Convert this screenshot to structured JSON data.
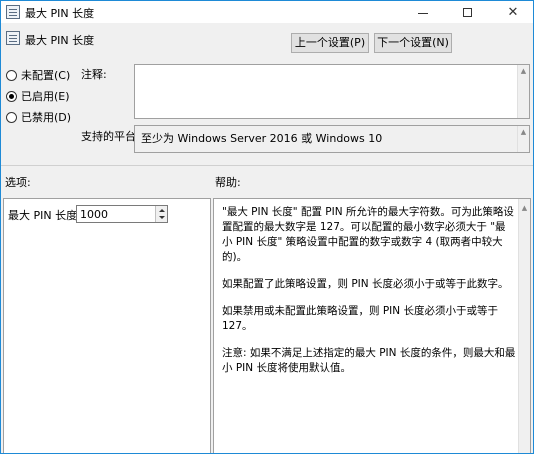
{
  "window": {
    "title": "最大 PIN 长度"
  },
  "header": {
    "title": "最大 PIN 长度",
    "prev_button": "上一个设置(P)",
    "next_button": "下一个设置(N)"
  },
  "state": {
    "options": [
      {
        "label": "未配置(C)",
        "selected": false
      },
      {
        "label": "已启用(E)",
        "selected": true
      },
      {
        "label": "已禁用(D)",
        "selected": false
      }
    ]
  },
  "comment": {
    "label": "注释:",
    "value": ""
  },
  "platform": {
    "label": "支持的平台:",
    "value": "至少为 Windows Server 2016 或 Windows 10"
  },
  "options_section": {
    "label": "选项:",
    "field_label": "最大 PIN 长度",
    "field_value": "1000"
  },
  "help_section": {
    "label": "帮助:",
    "paragraphs": [
      "\"最大 PIN 长度\" 配置 PIN 所允许的最大字符数。可为此策略设置配置的最大数字是 127。可以配置的最小数字必须大于 \"最小 PIN 长度\" 策略设置中配置的数字或数字 4 (取两者中较大的)。",
      "如果配置了此策略设置，则 PIN 长度必须小于或等于此数字。",
      "如果禁用或未配置此策略设置，则 PIN 长度必须小于或等于 127。",
      "注意: 如果不满足上述指定的最大 PIN 长度的条件，则最大和最小 PIN 长度将使用默认值。"
    ]
  }
}
